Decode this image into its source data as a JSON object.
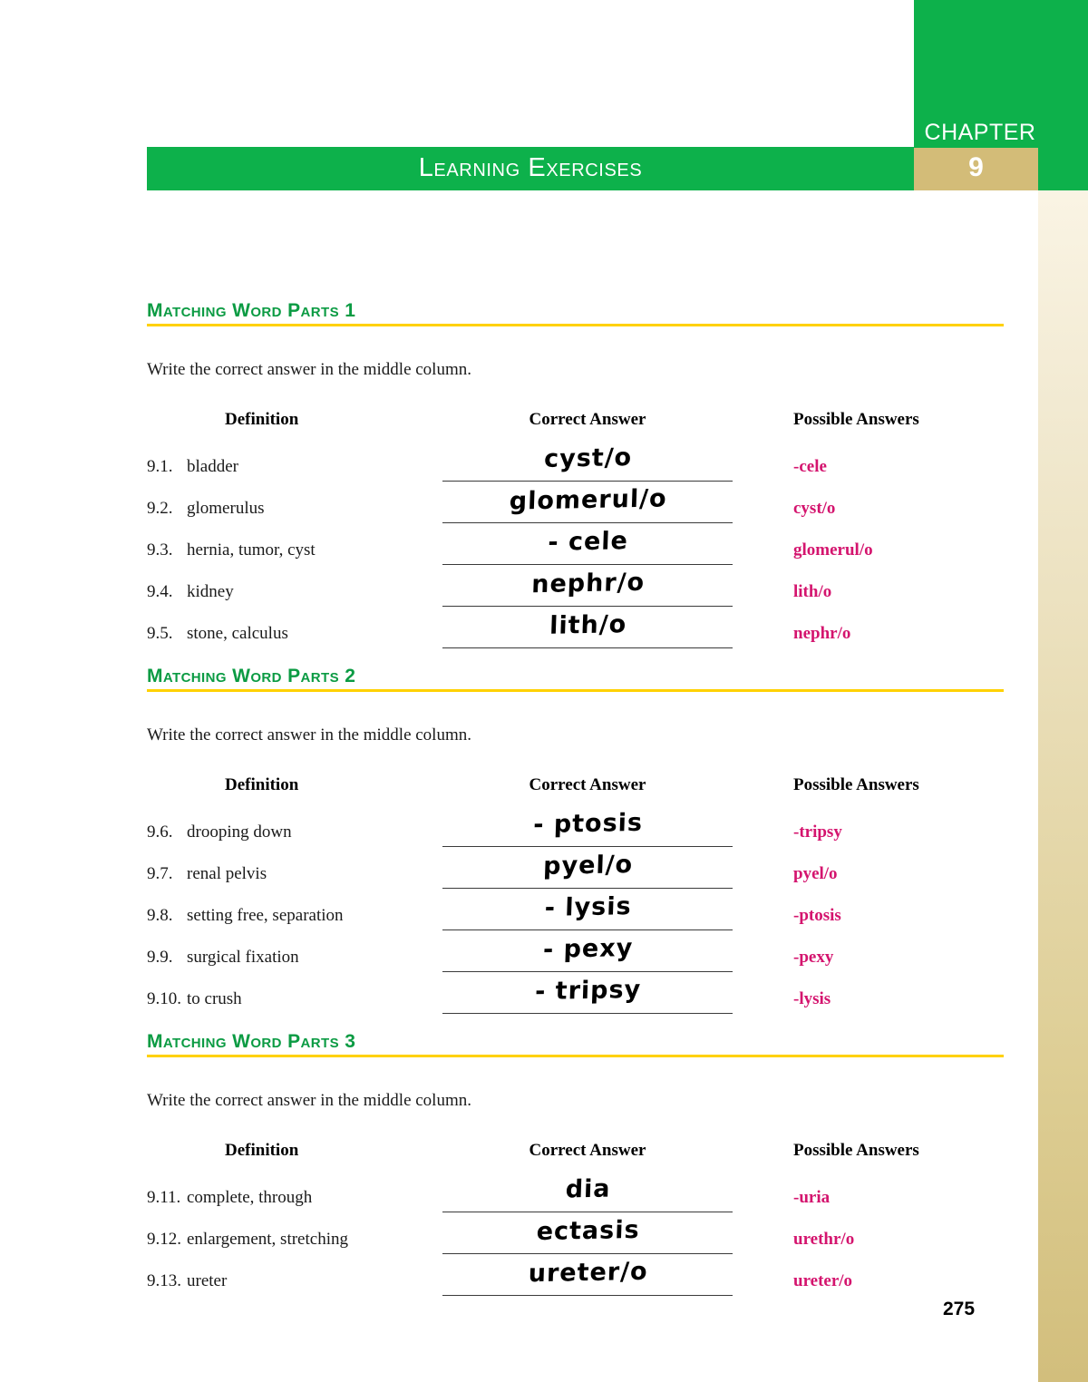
{
  "page": {
    "number": "275",
    "chapter_label": "CHAPTER",
    "chapter_number": "9",
    "banner_title": "Learning Exercises",
    "accent_green": "#0DB14B",
    "accent_yellow": "#FFD100",
    "accent_magenta": "#D4146E",
    "accent_tan": "#d3bc78"
  },
  "sections": [
    {
      "heading": "Matching Word Parts 1",
      "instruction": "Write the correct answer in the middle column.",
      "columns": {
        "definition": "Definition",
        "correct_answer": "Correct Answer",
        "possible_answers": "Possible Answers"
      },
      "rows": [
        {
          "num": "9.1.",
          "definition": "bladder",
          "handwritten": "cyst/o",
          "possible": "-cele"
        },
        {
          "num": "9.2.",
          "definition": "glomerulus",
          "handwritten": "glomerul/o",
          "possible": "cyst/o"
        },
        {
          "num": "9.3.",
          "definition": "hernia, tumor, cyst",
          "handwritten": "- cele",
          "possible": "glomerul/o"
        },
        {
          "num": "9.4.",
          "definition": "kidney",
          "handwritten": "nephr/o",
          "possible": "lith/o"
        },
        {
          "num": "9.5.",
          "definition": "stone, calculus",
          "handwritten": "lith/o",
          "possible": "nephr/o"
        }
      ]
    },
    {
      "heading": "Matching Word Parts 2",
      "instruction": "Write the correct answer in the middle column.",
      "columns": {
        "definition": "Definition",
        "correct_answer": "Correct Answer",
        "possible_answers": "Possible Answers"
      },
      "rows": [
        {
          "num": "9.6.",
          "definition": "drooping down",
          "handwritten": "- ptosis",
          "possible": "-tripsy"
        },
        {
          "num": "9.7.",
          "definition": "renal pelvis",
          "handwritten": "pyel/o",
          "possible": "pyel/o"
        },
        {
          "num": "9.8.",
          "definition": "setting free, separation",
          "handwritten": "- lysis",
          "possible": "-ptosis"
        },
        {
          "num": "9.9.",
          "definition": "surgical fixation",
          "handwritten": "- pexy",
          "possible": "-pexy"
        },
        {
          "num": "9.10.",
          "definition": "to crush",
          "handwritten": "- tripsy",
          "possible": "-lysis"
        }
      ]
    },
    {
      "heading": "Matching Word Parts 3",
      "instruction": "Write the correct answer in the middle column.",
      "columns": {
        "definition": "Definition",
        "correct_answer": "Correct Answer",
        "possible_answers": "Possible Answers"
      },
      "rows": [
        {
          "num": "9.11.",
          "definition": "complete, through",
          "handwritten": "dia",
          "possible": "-uria"
        },
        {
          "num": "9.12.",
          "definition": "enlargement, stretching",
          "handwritten": "ectasis",
          "possible": "urethr/o"
        },
        {
          "num": "9.13.",
          "definition": "ureter",
          "handwritten": "ureter/o",
          "possible": "ureter/o"
        }
      ]
    }
  ]
}
